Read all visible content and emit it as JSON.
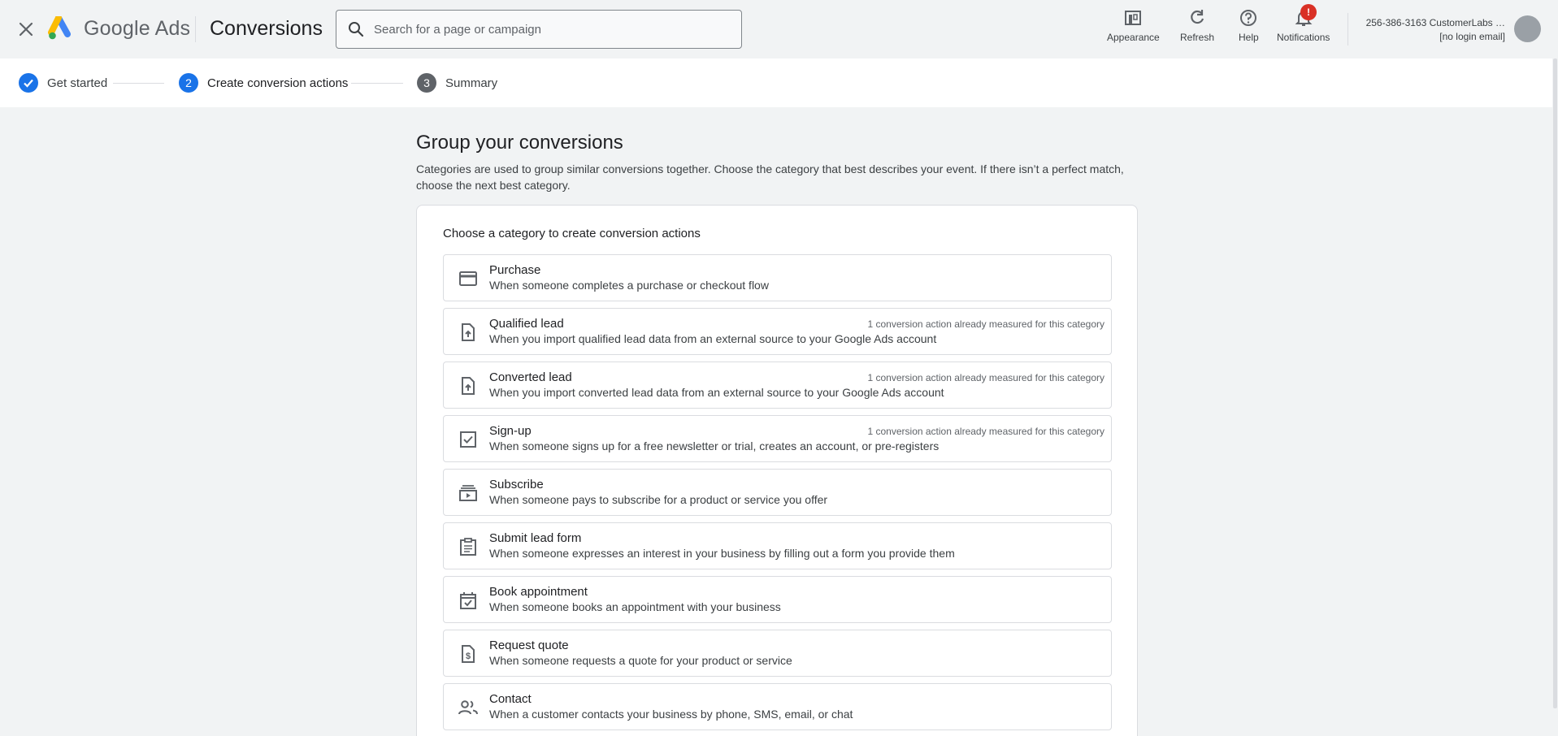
{
  "header": {
    "product_name": "Google Ads",
    "page_title": "Conversions",
    "search_placeholder": "Search for a page or campaign",
    "tools": [
      {
        "label": "Appearance",
        "icon": "appearance-icon"
      },
      {
        "label": "Refresh",
        "icon": "refresh-icon"
      },
      {
        "label": "Help",
        "icon": "help-icon"
      },
      {
        "label": "Notifications",
        "icon": "bell-icon",
        "badge": "!"
      }
    ],
    "account": {
      "name": "256-386-3163 CustomerLabs …",
      "email": "[no login email]"
    }
  },
  "stepper": {
    "steps": [
      {
        "number": "✓",
        "label": "Get started",
        "state": "done"
      },
      {
        "number": "2",
        "label": "Create conversion actions",
        "state": "active"
      },
      {
        "number": "3",
        "label": "Summary",
        "state": "pending"
      }
    ]
  },
  "main": {
    "title": "Group your conversions",
    "description": "Categories are used to group similar conversions together. Choose the category that best describes your event. If there isn’t a perfect match, choose the next best category.",
    "card_title": "Choose a category to create conversion actions",
    "categories": [
      {
        "title": "Purchase",
        "description": "When someone completes a purchase or checkout flow",
        "note": "",
        "icon": "credit-card-icon"
      },
      {
        "title": "Qualified lead",
        "description": "When you import qualified lead data from an external source to your Google Ads account",
        "note": "1 conversion action already measured for this category",
        "icon": "file-upload-icon"
      },
      {
        "title": "Converted lead",
        "description": "When you import converted lead data from an external source to your Google Ads account",
        "note": "1 conversion action already measured for this category",
        "icon": "file-upload-icon"
      },
      {
        "title": "Sign-up",
        "description": "When someone signs up for a free newsletter or trial, creates an account, or pre-registers",
        "note": "1 conversion action already measured for this category",
        "icon": "checkbox-icon"
      },
      {
        "title": "Subscribe",
        "description": "When someone pays to subscribe for a product or service you offer",
        "note": "",
        "icon": "subscriptions-icon"
      },
      {
        "title": "Submit lead form",
        "description": "When someone expresses an interest in your business by filling out a form you provide them",
        "note": "",
        "icon": "clipboard-icon"
      },
      {
        "title": "Book appointment",
        "description": "When someone books an appointment with your business",
        "note": "",
        "icon": "event-available-icon"
      },
      {
        "title": "Request quote",
        "description": "When someone requests a quote for your product or service",
        "note": "",
        "icon": "request-quote-icon"
      },
      {
        "title": "Contact",
        "description": "When a customer contacts your business by phone, SMS, email, or chat",
        "note": "",
        "icon": "people-icon"
      }
    ]
  },
  "colors": {
    "primary_blue": "#1a73e8",
    "header_bg": "#f1f3f4",
    "notification_red": "#d93025",
    "step_pending": "#5f6368"
  }
}
